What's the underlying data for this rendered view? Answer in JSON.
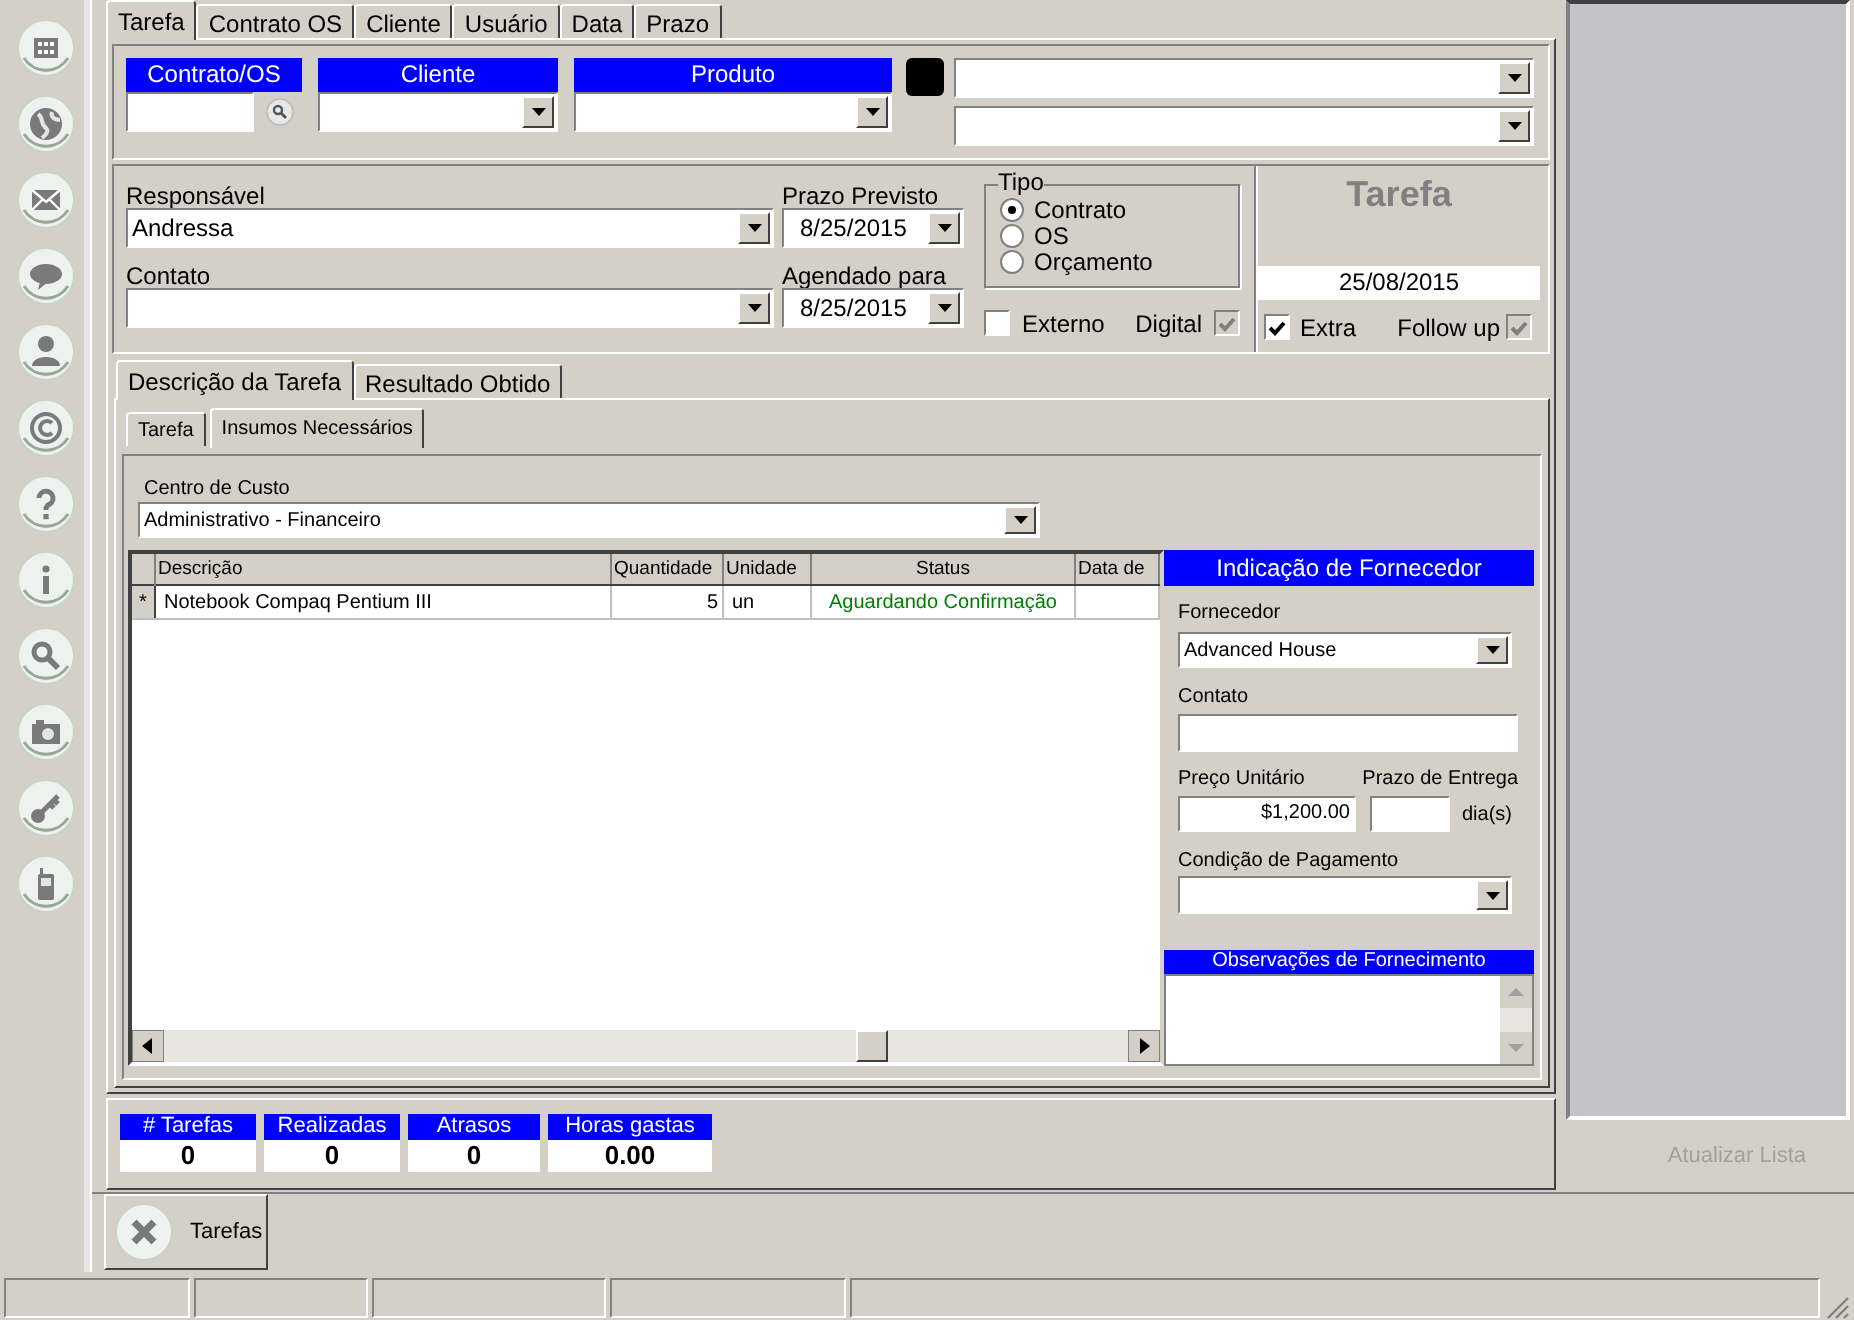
{
  "top_tabs": [
    {
      "label": "Tarefa",
      "selected": true
    },
    {
      "label": "Contrato OS",
      "selected": false
    },
    {
      "label": "Cliente",
      "selected": false
    },
    {
      "label": "Usuário",
      "selected": false
    },
    {
      "label": "Data",
      "selected": false
    },
    {
      "label": "Prazo",
      "selected": false
    }
  ],
  "filters": [
    {
      "label": "Contrato/OS",
      "kind": "search"
    },
    {
      "label": "Cliente",
      "kind": "combo"
    },
    {
      "label": "Produto",
      "kind": "combo"
    }
  ],
  "responsavel": {
    "label": "Responsável",
    "value": "Andressa"
  },
  "contato": {
    "label": "Contato"
  },
  "prazo_previsto": {
    "label": "Prazo Previsto",
    "value": "8/25/2015"
  },
  "agendado_para": {
    "label": "Agendado para",
    "value": "8/25/2015"
  },
  "tipo": {
    "label": "Tipo",
    "options": [
      {
        "label": "Contrato",
        "selected": true
      },
      {
        "label": "OS",
        "selected": false
      },
      {
        "label": "Orçamento",
        "selected": false
      }
    ]
  },
  "checks": [
    {
      "label": "Externo",
      "checked": false,
      "disabled": false
    },
    {
      "label": "Digital",
      "checked": true,
      "disabled": true
    }
  ],
  "task_panel": {
    "title": "Tarefa",
    "date": "25/08/2015",
    "checks": [
      {
        "label": "Extra",
        "checked": true,
        "disabled": false
      },
      {
        "label": "Follow up",
        "checked": true,
        "disabled": true
      }
    ]
  },
  "section_tabs": [
    {
      "label": "Descrição da Tarefa",
      "selected": true
    },
    {
      "label": "Resultado Obtido",
      "selected": false
    }
  ],
  "sub_tabs": [
    {
      "label": "Tarefa",
      "selected": false
    },
    {
      "label": "Insumos Necessários",
      "selected": true
    }
  ],
  "centro_de_custo": {
    "label": "Centro de Custo",
    "value": "Administrativo - Financeiro"
  },
  "items_table": {
    "columns": [
      "Descrição",
      "Quantidade",
      "Unidade",
      "Status",
      "Data de"
    ],
    "rows": [
      {
        "marker": "*",
        "cells": [
          "Notebook Compaq Pentium III",
          "5",
          "un",
          "Aguardando Confirmação"
        ]
      }
    ]
  },
  "supplier": {
    "title": "Indicação de Fornecedor",
    "fornecedor": {
      "label": "Fornecedor",
      "value": "Advanced House"
    },
    "contato": {
      "label": "Contato"
    },
    "preco": {
      "label": "Preço Unitário",
      "value": "$1,200.00"
    },
    "prazo_entrega": {
      "label": "Prazo de Entrega",
      "unit": "dia(s)"
    },
    "condicao": {
      "label": "Condição de Pagamento"
    },
    "observacoes": {
      "label": "Observações de Fornecimento"
    }
  },
  "summary": [
    {
      "label": "# Tarefas",
      "value": "0"
    },
    {
      "label": "Realizadas",
      "value": "0"
    },
    {
      "label": "Atrasos",
      "value": "0"
    },
    {
      "label": "Horas gastas",
      "value": "0.00"
    }
  ],
  "right_panel": {
    "button": {
      "label": "Atualizar Lista",
      "disabled": true
    }
  },
  "bottom_tabs": [
    {
      "label": "Tarefas"
    }
  ]
}
